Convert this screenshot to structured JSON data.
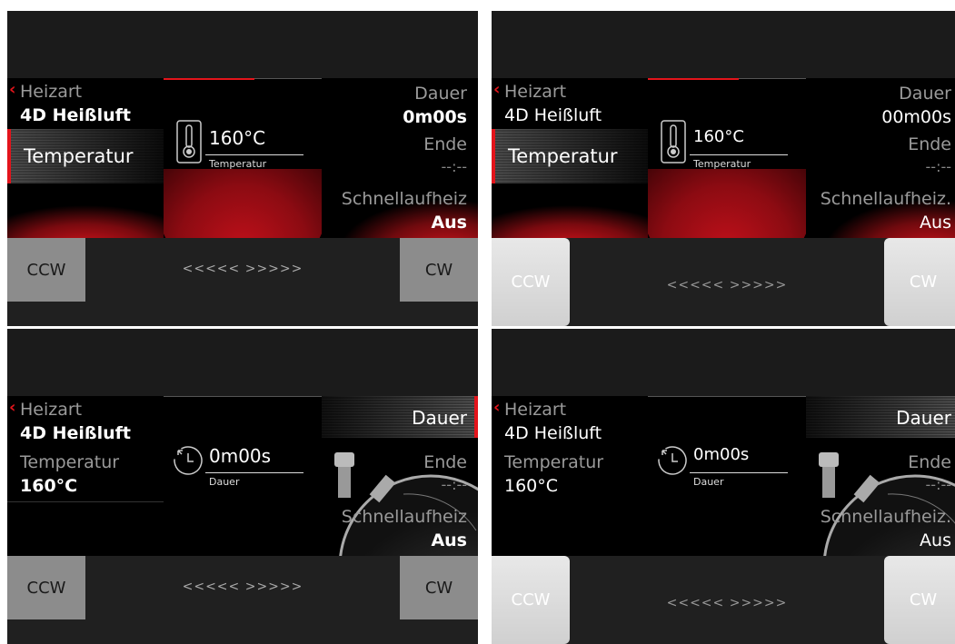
{
  "panels": [
    {
      "heizart_label": "Heizart",
      "heizart_value": "4D Heißluft",
      "temperatur_label": "Temperatur",
      "temperatur_value": "",
      "center_value": "160°C",
      "center_caption": "Temperatur",
      "dauer_label": "Dauer",
      "dauer_value": "0m00s",
      "ende_label": "Ende",
      "ende_value": "--:--",
      "schnell_label": "Schnellaufheiz",
      "schnell_value": "Aus",
      "ccw": "CCW",
      "cw": "CW",
      "arrows": "<<<<<  >>>>>"
    },
    {
      "heizart_label": "Heizart",
      "heizart_value": "4D Heißluft",
      "temperatur_label": "Temperatur",
      "temperatur_value": "",
      "center_value": "160°C",
      "center_caption": "Temperatur",
      "dauer_label": "Dauer",
      "dauer_value": "00m00s",
      "ende_label": "Ende",
      "ende_value": "--:--",
      "schnell_label": "Schnellaufheiz.",
      "schnell_value": "Aus",
      "ccw": "CCW",
      "cw": "CW",
      "arrows": "<<<<<  >>>>>"
    },
    {
      "heizart_label": "Heizart",
      "heizart_value": "4D Heißluft",
      "temperatur_label": "Temperatur",
      "temperatur_value": "160°C",
      "center_value": "0m00s",
      "center_caption": "Dauer",
      "dauer_label": "Dauer",
      "dauer_value": "",
      "ende_label": "Ende",
      "ende_value": "--:--",
      "schnell_label": "Schnellaufheiz",
      "schnell_value": "Aus",
      "ccw": "CCW",
      "cw": "CW",
      "arrows": "<<<<<  >>>>>"
    },
    {
      "heizart_label": "Heizart",
      "heizart_value": "4D Heißluft",
      "temperatur_label": "Temperatur",
      "temperatur_value": "160°C",
      "center_value": "0m00s",
      "center_caption": "Dauer",
      "dauer_label": "Dauer",
      "dauer_value": "",
      "ende_label": "Ende",
      "ende_value": "--:--",
      "schnell_label": "Schnellaufheiz.",
      "schnell_value": "Aus",
      "ccw": "CCW",
      "cw": "CW",
      "arrows": "<<<<<  >>>>>"
    }
  ],
  "colors": {
    "accent": "#e3141b",
    "panel_bg": "#161616",
    "button_gray": "#8c8c8c"
  },
  "icons": {
    "back": "chevron-left-icon",
    "thermometer": "thermometer-icon",
    "timer": "timer-icon",
    "stopwatch": "stopwatch-image"
  }
}
